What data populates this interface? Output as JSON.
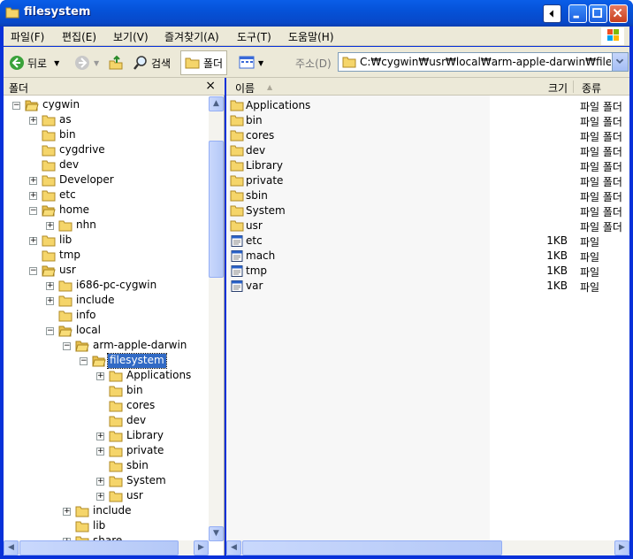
{
  "window": {
    "title": "filesystem"
  },
  "menu": [
    "파일(F)",
    "편집(E)",
    "보기(V)",
    "즐겨찾기(A)",
    "도구(T)",
    "도움말(H)"
  ],
  "toolbar": {
    "back": "뒤로",
    "search": "검색",
    "folders": "폴더",
    "address_label": "주소(D)",
    "address_value": "C:₩cygwin₩usr₩local₩arm-apple-darwin₩filesy"
  },
  "left_pane": {
    "title": "폴더",
    "close": "×"
  },
  "tree": [
    {
      "label": "cygwin",
      "expander": "−"
    },
    {
      "label": "as",
      "expander": "+"
    },
    {
      "label": "bin",
      "expander": ""
    },
    {
      "label": "cygdrive",
      "expander": ""
    },
    {
      "label": "dev",
      "expander": ""
    },
    {
      "label": "Developer",
      "expander": "+"
    },
    {
      "label": "etc",
      "expander": "+"
    },
    {
      "label": "home",
      "expander": "−"
    },
    {
      "label": "nhn",
      "expander": "+"
    },
    {
      "label": "lib",
      "expander": "+"
    },
    {
      "label": "tmp",
      "expander": ""
    },
    {
      "label": "usr",
      "expander": "−"
    },
    {
      "label": "i686-pc-cygwin",
      "expander": "+"
    },
    {
      "label": "include",
      "expander": "+"
    },
    {
      "label": "info",
      "expander": ""
    },
    {
      "label": "local",
      "expander": "−"
    },
    {
      "label": "arm-apple-darwin",
      "expander": "−"
    },
    {
      "label": "filesystem",
      "expander": "−"
    },
    {
      "label": "Applications",
      "expander": "+"
    },
    {
      "label": "bin",
      "expander": ""
    },
    {
      "label": "cores",
      "expander": ""
    },
    {
      "label": "dev",
      "expander": ""
    },
    {
      "label": "Library",
      "expander": "+"
    },
    {
      "label": "private",
      "expander": "+"
    },
    {
      "label": "sbin",
      "expander": ""
    },
    {
      "label": "System",
      "expander": "+"
    },
    {
      "label": "usr",
      "expander": "+"
    },
    {
      "label": "include",
      "expander": "+"
    },
    {
      "label": "lib",
      "expander": ""
    },
    {
      "label": "share",
      "expander": "+"
    }
  ],
  "columns": {
    "name": "이름",
    "size": "크기",
    "type": "종류"
  },
  "files": [
    {
      "name": "Applications",
      "size": "",
      "type": "파일 폴더",
      "kind": "folder"
    },
    {
      "name": "bin",
      "size": "",
      "type": "파일 폴더",
      "kind": "folder"
    },
    {
      "name": "cores",
      "size": "",
      "type": "파일 폴더",
      "kind": "folder"
    },
    {
      "name": "dev",
      "size": "",
      "type": "파일 폴더",
      "kind": "folder"
    },
    {
      "name": "Library",
      "size": "",
      "type": "파일 폴더",
      "kind": "folder"
    },
    {
      "name": "private",
      "size": "",
      "type": "파일 폴더",
      "kind": "folder"
    },
    {
      "name": "sbin",
      "size": "",
      "type": "파일 폴더",
      "kind": "folder"
    },
    {
      "name": "System",
      "size": "",
      "type": "파일 폴더",
      "kind": "folder"
    },
    {
      "name": "usr",
      "size": "",
      "type": "파일 폴더",
      "kind": "folder"
    },
    {
      "name": "etc",
      "size": "1KB",
      "type": "파일",
      "kind": "file"
    },
    {
      "name": "mach",
      "size": "1KB",
      "type": "파일",
      "kind": "file"
    },
    {
      "name": "tmp",
      "size": "1KB",
      "type": "파일",
      "kind": "file"
    },
    {
      "name": "var",
      "size": "1KB",
      "type": "파일",
      "kind": "file"
    }
  ],
  "colors": {
    "titlebar": "#0a5ee8",
    "selection": "#316ac5",
    "chrome": "#ece9d8",
    "folder": "#f2cf5c"
  }
}
